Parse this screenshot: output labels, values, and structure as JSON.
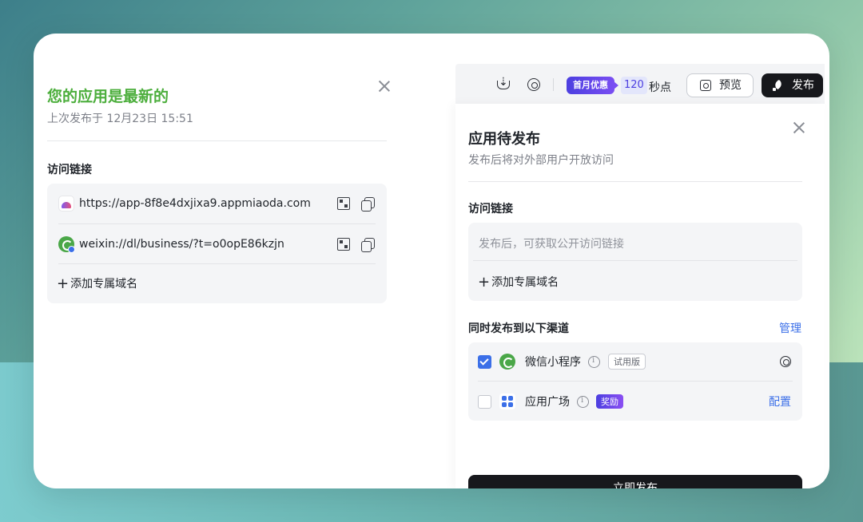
{
  "left_panel": {
    "title": "您的应用是最新的",
    "subtitle": "上次发布于 12月23日 15:51",
    "section_label": "访问链接",
    "links": [
      {
        "url": "https://app-8f8e4dxjixa9.appmiaoda.com",
        "icon": "app-logo-icon"
      },
      {
        "url": "weixin://dl/business/?t=o0opE86kzjn",
        "icon": "weixin-logo-icon"
      }
    ],
    "add_domain_label": "添加专属域名"
  },
  "toolbar": {
    "promo_label": "首月优惠",
    "countdown_value": "120",
    "countdown_unit": "秒点",
    "preview_label": "预览",
    "publish_label": "发布"
  },
  "dialog": {
    "title": "应用待发布",
    "subtitle": "发布后将对外部用户开放访问",
    "access_label": "访问链接",
    "access_placeholder": "发布后，可获取公开访问链接",
    "add_domain_label": "添加专属域名",
    "channels_label": "同时发布到以下渠道",
    "manage_label": "管理",
    "channels": [
      {
        "name": "微信小程序",
        "checked": true,
        "tag": "试用版"
      },
      {
        "name": "应用广场",
        "checked": false,
        "tag": "奖励",
        "action": "配置"
      }
    ],
    "publish_now_label": "立即发布"
  },
  "colors": {
    "success_green": "#4cae3c",
    "accent_blue": "#3b6fe8",
    "promo_purple": "#4c3fe0",
    "dark_button": "#17181c"
  }
}
